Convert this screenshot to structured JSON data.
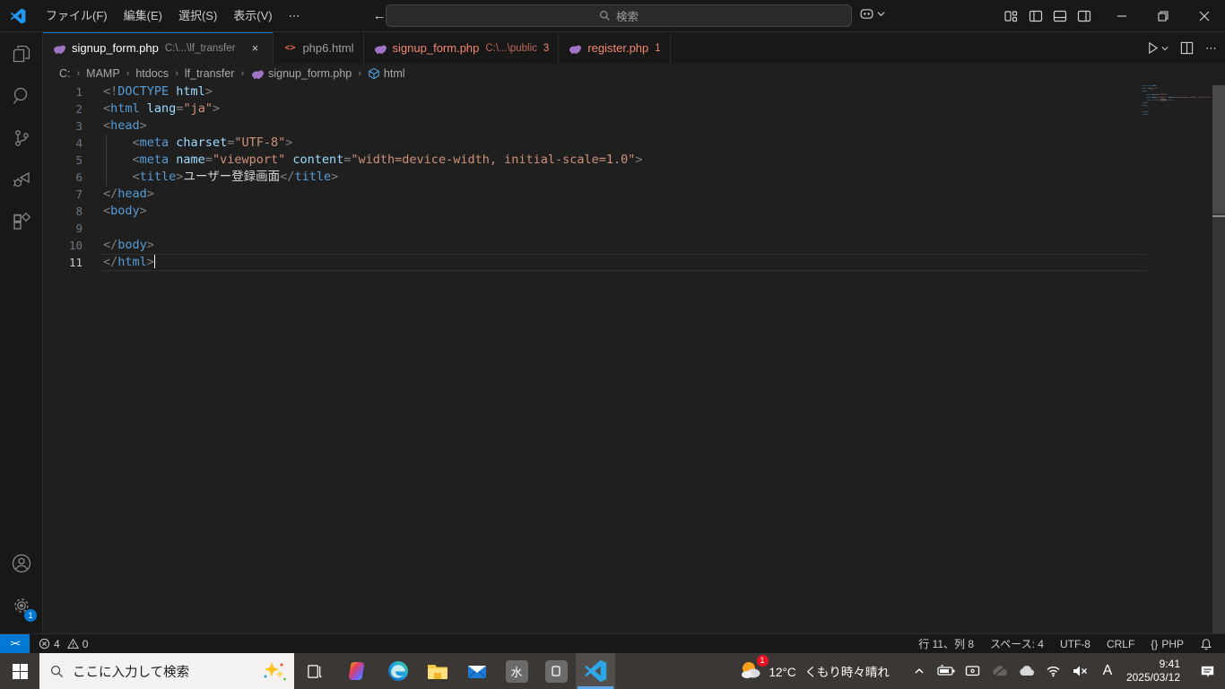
{
  "colors": {
    "accent": "#0078d4",
    "error_tab": "#f48771",
    "tag": "#569cd6",
    "attr": "#9cdcfe",
    "string": "#ce9178"
  },
  "title_bar": {
    "menus": [
      {
        "id": "file",
        "label": "ファイル(F)"
      },
      {
        "id": "edit",
        "label": "編集(E)"
      },
      {
        "id": "selection",
        "label": "選択(S)"
      },
      {
        "id": "view",
        "label": "表示(V)"
      },
      {
        "id": "more",
        "label": "⋯"
      }
    ],
    "search_placeholder": "検索"
  },
  "tab_bar": {
    "tabs": [
      {
        "label": "signup_form.php",
        "detail": "C:\\...\\lf_transfer",
        "icon": "php",
        "active": true,
        "error": false,
        "badge": "",
        "closable": true
      },
      {
        "label": "php6.html",
        "detail": "",
        "icon": "html",
        "active": false,
        "error": false,
        "badge": ""
      },
      {
        "label": "signup_form.php",
        "detail": "C:\\...\\public",
        "icon": "php",
        "active": false,
        "error": true,
        "badge": "3"
      },
      {
        "label": "register.php",
        "detail": "",
        "icon": "php",
        "active": false,
        "error": true,
        "badge": "1"
      }
    ]
  },
  "breadcrumb": {
    "items": [
      {
        "label": "C:",
        "icon": ""
      },
      {
        "label": "MAMP",
        "icon": ""
      },
      {
        "label": "htdocs",
        "icon": ""
      },
      {
        "label": "lf_transfer",
        "icon": ""
      },
      {
        "label": "signup_form.php",
        "icon": "php"
      },
      {
        "label": "html",
        "icon": "symbol-cube"
      }
    ]
  },
  "editor": {
    "lines": [
      {
        "n": "1",
        "tokens": [
          [
            "p",
            "<!"
          ],
          [
            "t",
            "DOCTYPE"
          ],
          [
            "a",
            " html"
          ],
          [
            "p",
            ">"
          ]
        ]
      },
      {
        "n": "2",
        "tokens": [
          [
            "p",
            "<"
          ],
          [
            "t",
            "html"
          ],
          [
            "a",
            " lang"
          ],
          [
            "p",
            "="
          ],
          [
            "s",
            "\"ja\""
          ],
          [
            "p",
            ">"
          ]
        ]
      },
      {
        "n": "3",
        "tokens": [
          [
            "p",
            "<"
          ],
          [
            "t",
            "head"
          ],
          [
            "p",
            ">"
          ]
        ]
      },
      {
        "n": "4",
        "tokens": [
          [
            "w",
            "    "
          ],
          [
            "p",
            "<"
          ],
          [
            "t",
            "meta"
          ],
          [
            "a",
            " charset"
          ],
          [
            "p",
            "="
          ],
          [
            "s",
            "\"UTF-8\""
          ],
          [
            "p",
            ">"
          ]
        ]
      },
      {
        "n": "5",
        "tokens": [
          [
            "w",
            "    "
          ],
          [
            "p",
            "<"
          ],
          [
            "t",
            "meta"
          ],
          [
            "a",
            " name"
          ],
          [
            "p",
            "="
          ],
          [
            "s",
            "\"viewport\""
          ],
          [
            "a",
            " content"
          ],
          [
            "p",
            "="
          ],
          [
            "s",
            "\"width=device-width, initial-scale=1.0\""
          ],
          [
            "p",
            ">"
          ]
        ]
      },
      {
        "n": "6",
        "tokens": [
          [
            "w",
            "    "
          ],
          [
            "p",
            "<"
          ],
          [
            "t",
            "title"
          ],
          [
            "p",
            ">"
          ],
          [
            "x",
            "ユーザー登録画面"
          ],
          [
            "p",
            "</"
          ],
          [
            "t",
            "title"
          ],
          [
            "p",
            ">"
          ]
        ]
      },
      {
        "n": "7",
        "tokens": [
          [
            "p",
            "</"
          ],
          [
            "t",
            "head"
          ],
          [
            "p",
            ">"
          ]
        ]
      },
      {
        "n": "8",
        "tokens": [
          [
            "p",
            "<"
          ],
          [
            "t",
            "body"
          ],
          [
            "p",
            ">"
          ]
        ]
      },
      {
        "n": "9",
        "tokens": []
      },
      {
        "n": "10",
        "tokens": [
          [
            "p",
            "</"
          ],
          [
            "t",
            "body"
          ],
          [
            "p",
            ">"
          ]
        ]
      },
      {
        "n": "11",
        "tokens": [
          [
            "p",
            "</"
          ],
          [
            "t",
            "html"
          ],
          [
            "p",
            ">"
          ]
        ],
        "current": true,
        "cursor": true
      }
    ]
  },
  "status_bar": {
    "errors": "4",
    "warnings": "0",
    "cursor_position": "行 11、列 8",
    "indentation": "スペース: 4",
    "encoding": "UTF-8",
    "eol": "CRLF",
    "language_icon": "{}",
    "language": "PHP"
  },
  "taskbar": {
    "search_placeholder": "ここに入力して検索",
    "apps": [
      {
        "icon": "copilot",
        "active": false
      },
      {
        "icon": "edge",
        "active": false
      },
      {
        "icon": "explorer",
        "active": false
      },
      {
        "icon": "mail",
        "active": false
      },
      {
        "icon": "kanji-sui",
        "glyph": "水",
        "active": false
      },
      {
        "icon": "widget-app",
        "active": false
      },
      {
        "icon": "vscode",
        "active": true
      }
    ],
    "weather_badge": "1",
    "weather_temp": "12°C",
    "weather_desc": "くもり時々晴れ",
    "tray_icons": [
      "chevron-up",
      "battery",
      "display",
      "onedrive-paused",
      "cloud",
      "wifi",
      "volume-muted",
      "ime-a"
    ],
    "ime_mode": "A",
    "time": "9:41",
    "date": "2025/03/12"
  }
}
